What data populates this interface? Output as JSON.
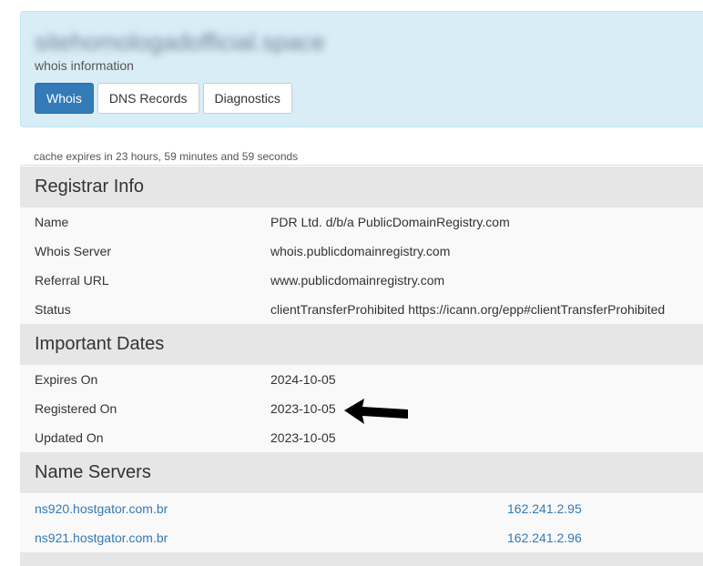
{
  "header": {
    "domain": "sitehomologadofficial.space",
    "subtitle": "whois information",
    "tabs": [
      {
        "label": "Whois",
        "active": true
      },
      {
        "label": "DNS Records",
        "active": false
      },
      {
        "label": "Diagnostics",
        "active": false
      }
    ]
  },
  "cache_note": "cache expires in 23 hours, 59 minutes and 59 seconds",
  "registrar": {
    "title": "Registrar Info",
    "rows": [
      {
        "label": "Name",
        "value": "PDR Ltd. d/b/a PublicDomainRegistry.com"
      },
      {
        "label": "Whois Server",
        "value": "whois.publicdomainregistry.com"
      },
      {
        "label": "Referral URL",
        "value": "www.publicdomainregistry.com"
      },
      {
        "label": "Status",
        "value": "clientTransferProhibited https://icann.org/epp#clientTransferProhibited"
      }
    ]
  },
  "dates": {
    "title": "Important Dates",
    "rows": [
      {
        "label": "Expires On",
        "value": "2024-10-05"
      },
      {
        "label": "Registered On",
        "value": "2023-10-05"
      },
      {
        "label": "Updated On",
        "value": "2023-10-05"
      }
    ]
  },
  "nameservers": {
    "title": "Name Servers",
    "rows": [
      {
        "host": "ns920.hostgator.com.br",
        "ip": "162.241.2.95"
      },
      {
        "host": "ns921.hostgator.com.br",
        "ip": "162.241.2.96"
      }
    ]
  },
  "colors": {
    "header_bg": "#d9edf7",
    "active_tab": "#337ab7",
    "section_bg": "#e6e6e6",
    "row_bg": "#f9f9f9",
    "link": "#337ab7"
  }
}
